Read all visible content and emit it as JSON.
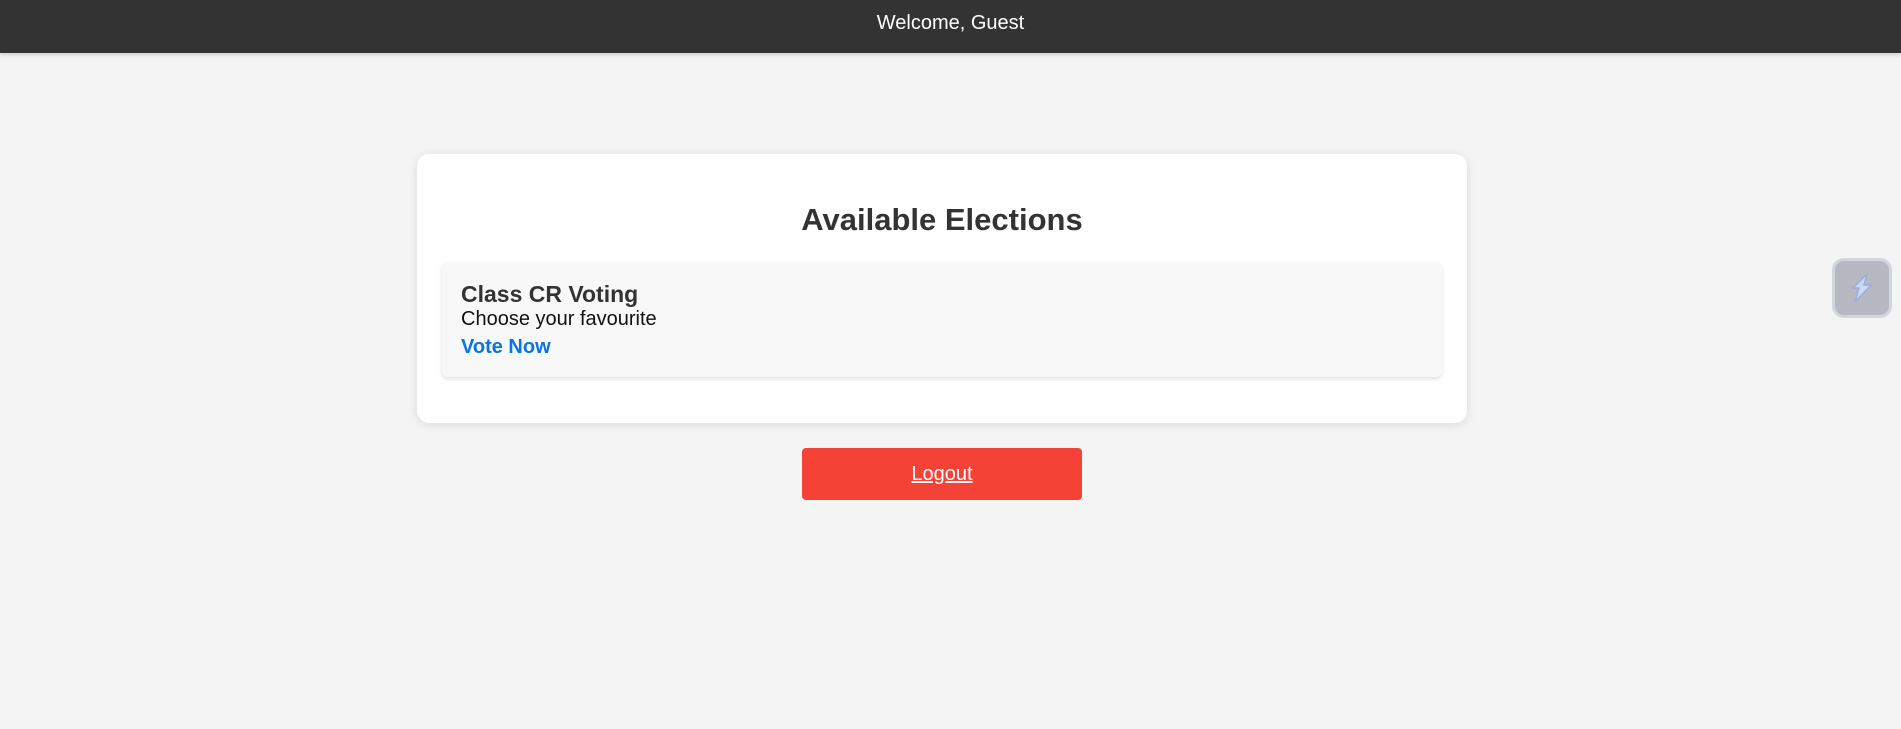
{
  "header": {
    "welcome_text": "Welcome, Guest"
  },
  "main": {
    "title": "Available Elections",
    "elections": [
      {
        "title": "Class CR Voting",
        "description": "Choose your favourite",
        "action_label": "Vote Now"
      }
    ],
    "logout_label": "Logout"
  },
  "side_widget": {
    "icon": "bolt-icon"
  },
  "colors": {
    "topbar": "#333333",
    "background": "#f4f4f4",
    "link": "#0a74e6",
    "logout": "#f44336"
  }
}
